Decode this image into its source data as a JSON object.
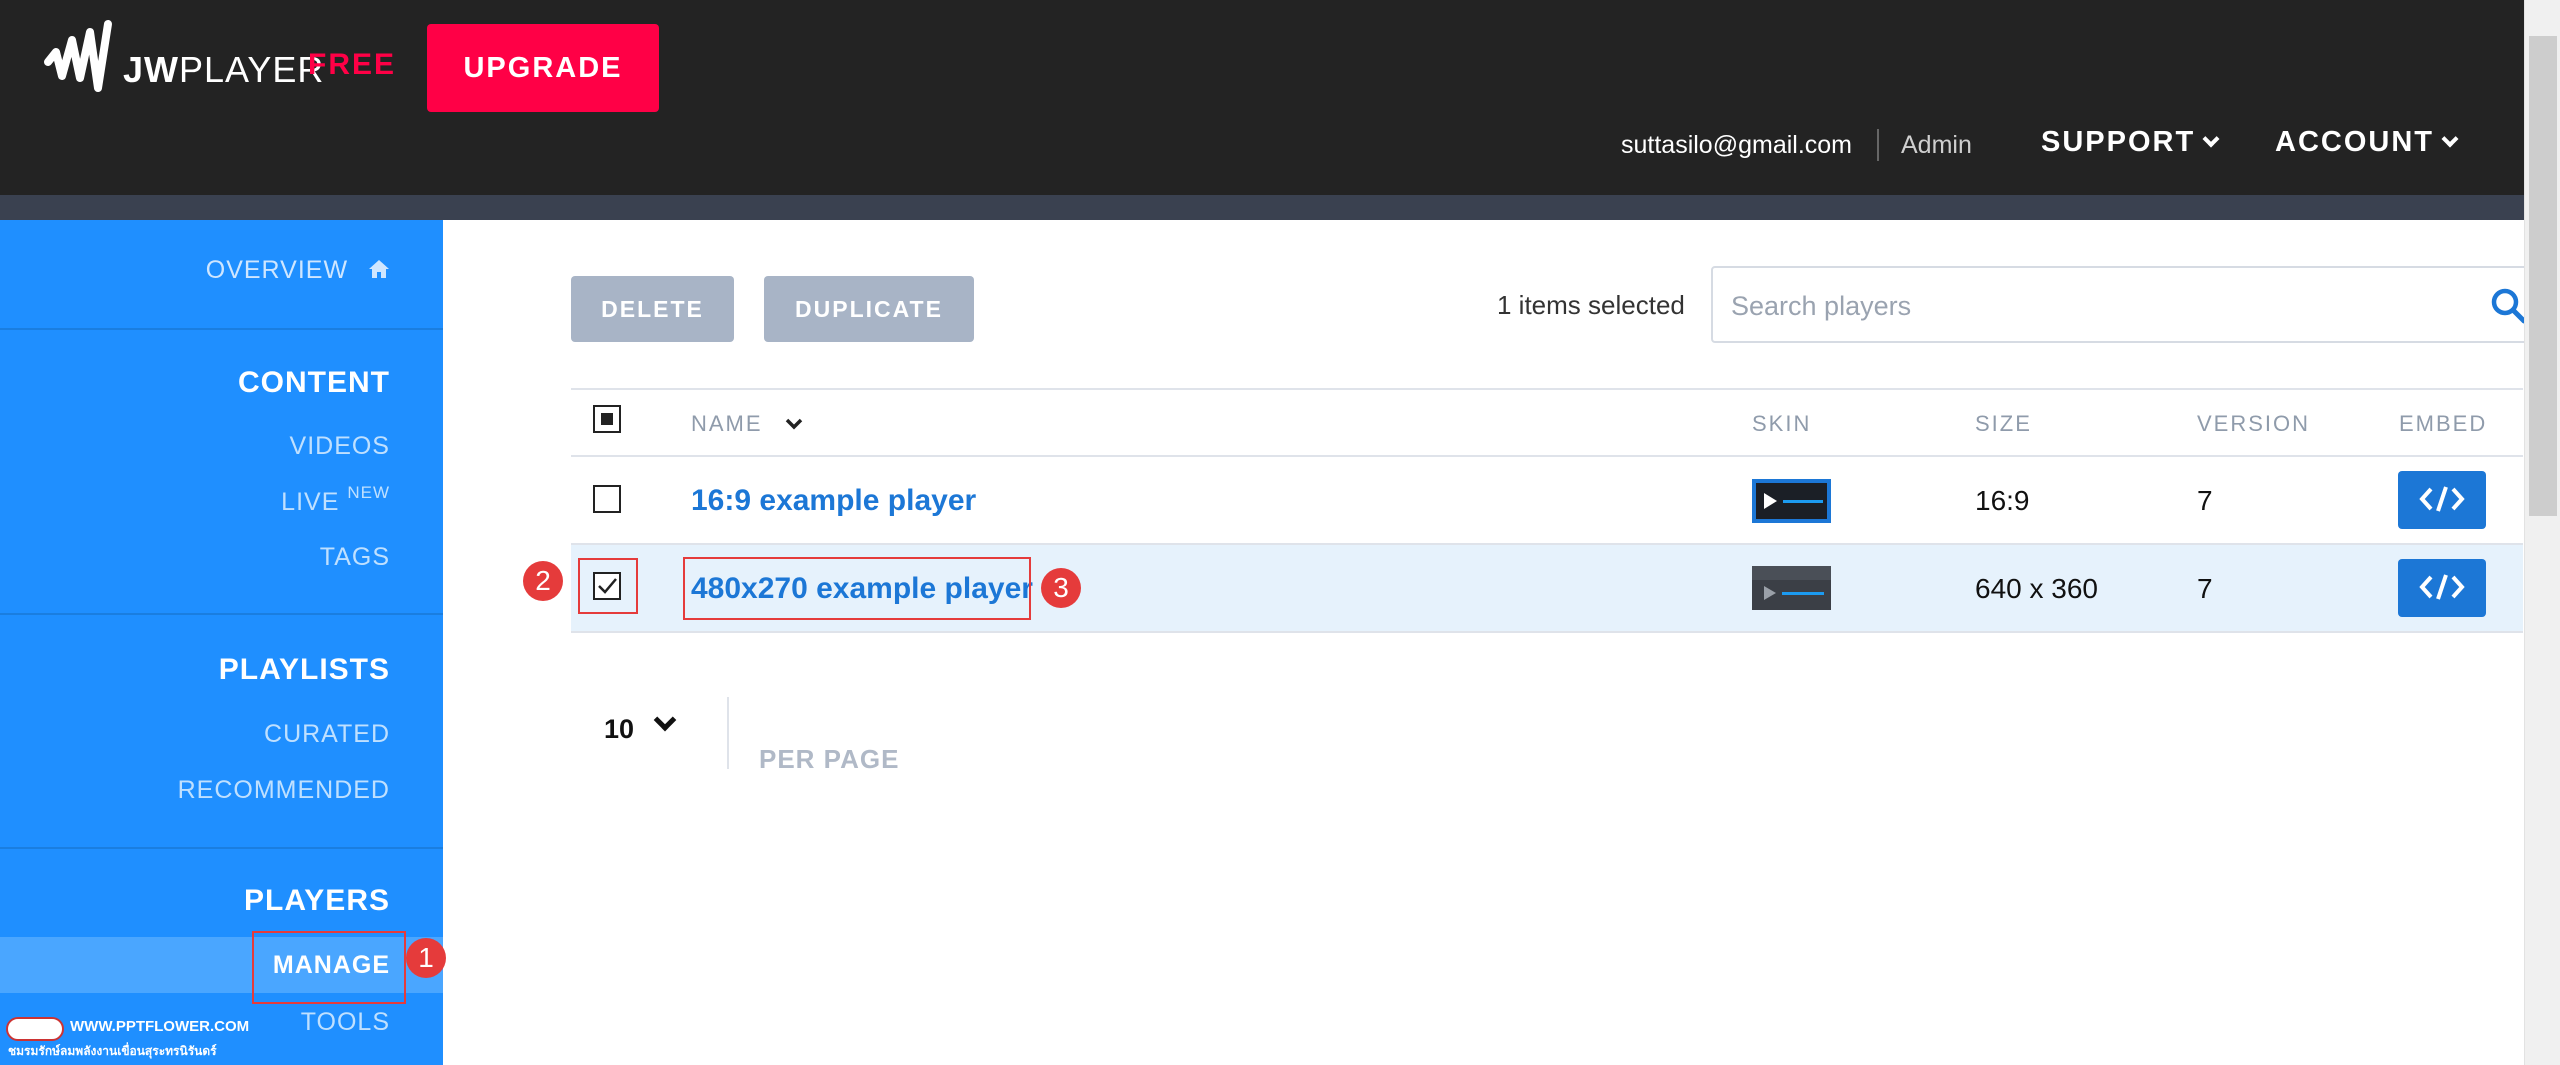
{
  "header": {
    "logo_text_bold": "JW",
    "logo_text_light": "PLAYER",
    "plan": "FREE",
    "upgrade_label": "UPGRADE",
    "user_email": "suttasilo@gmail.com",
    "user_role": "Admin",
    "nav": [
      {
        "label": "SUPPORT"
      },
      {
        "label": "ACCOUNT"
      }
    ],
    "accent_color": "#ff0046"
  },
  "sidebar": {
    "overview": "OVERVIEW",
    "content_heading": "CONTENT",
    "videos": "VIDEOS",
    "live": "LIVE",
    "live_badge": "NEW",
    "tags": "TAGS",
    "playlists_heading": "PLAYLISTS",
    "curated": "CURATED",
    "recommended": "RECOMMENDED",
    "players_heading": "PLAYERS",
    "manage": "MANAGE",
    "tools": "TOOLS",
    "background_color": "#1f8fff"
  },
  "toolbar": {
    "delete_label": "DELETE",
    "duplicate_label": "DUPLICATE",
    "selected_text": "1 items selected",
    "search_placeholder": "Search players"
  },
  "table": {
    "columns": [
      "NAME",
      "SKIN",
      "SIZE",
      "VERSION",
      "EMBED"
    ],
    "rows": [
      {
        "name": "16:9 example player",
        "size": "16:9",
        "version": "7",
        "checked": false
      },
      {
        "name": "480x270 example player",
        "size": "640 x 360",
        "version": "7",
        "checked": true
      }
    ]
  },
  "pagination": {
    "per_page_value": "10",
    "per_page_label": "PER PAGE"
  },
  "annotations": [
    "1",
    "2",
    "3"
  ],
  "watermark": {
    "line1": "WWW.PPTFLOWER.COM",
    "line2": "ชมรมรักษ์ลมพลังงานเขื่อนสุระทรนิรันดร์"
  }
}
